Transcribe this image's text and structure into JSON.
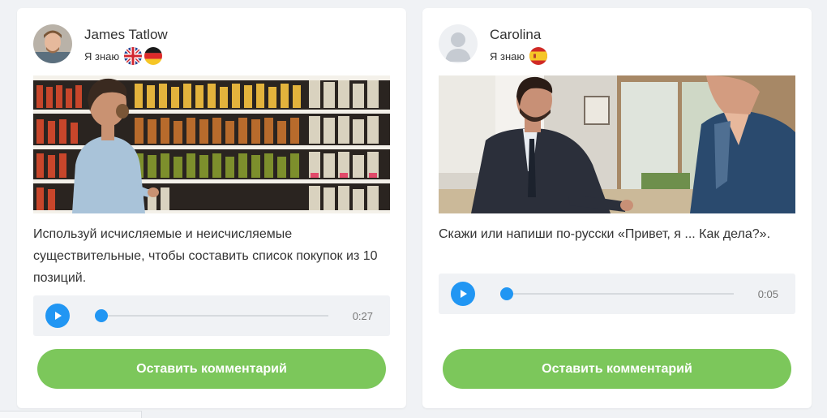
{
  "colors": {
    "accent": "#2196f3",
    "comment_button": "#7cc75b",
    "page_background": "#f0f2f5"
  },
  "cards": [
    {
      "author": "James Tatlow",
      "knows_label": "Я знаю",
      "flags": [
        "uk-flag-icon",
        "germany-flag-icon"
      ],
      "photo": "man-in-grocery-store-aisle",
      "task": "Используй исчисляемые и неисчисляемые существительные, чтобы составить список покупок из 10 позиций.",
      "audio": {
        "progress": 0,
        "duration": "0:27"
      },
      "comment_button": "Оставить комментарий"
    },
    {
      "author": "Carolina",
      "knows_label": "Я знаю",
      "flags": [
        "spain-flag-icon"
      ],
      "photo": "two-men-greeting-in-cafe",
      "task": "Скажи или напиши по-русски «Привет, я ... Как дела?».",
      "audio": {
        "progress": 0,
        "duration": "0:05"
      },
      "comment_button": "Оставить комментарий"
    }
  ]
}
